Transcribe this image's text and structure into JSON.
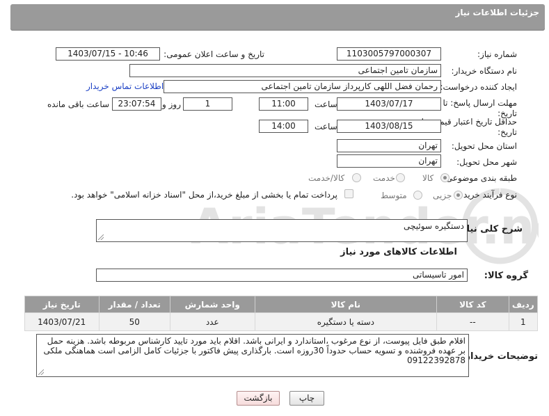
{
  "header": {
    "title": "جزئیات اطلاعات نیاز"
  },
  "form": {
    "need_number_label": "شماره نیاز:",
    "need_number": "1103005797000307",
    "announce_label": "تاریخ و ساعت اعلان عمومی:",
    "announce_value": "1403/07/15 - 10:46",
    "buyer_org_label": "نام دستگاه خریدار:",
    "buyer_org": "سازمان تامین اجتماعی",
    "requester_label": "ایجاد کننده درخواست:",
    "requester": "رحمان فضل اللهی کارپرداز سازمان تامین اجتماعی",
    "buyer_contact_link": "اطلاعات تماس خریدار",
    "reply_deadline_label_1": "مهلت ارسال پاسخ: تا",
    "reply_deadline_label_2": "تاریخ:",
    "reply_date": "1403/07/17",
    "time_label": "ساعت",
    "reply_time": "11:00",
    "days_value": "1",
    "days_label": "روز و",
    "remaining_time": "23:07:54",
    "remaining_label": "ساعت باقی مانده",
    "price_validity_label_1": "حداقل تاریخ اعتبار قیمت: تا",
    "price_validity_label_2": "تاریخ:",
    "validity_date": "1403/08/15",
    "validity_time": "14:00",
    "province_label": "استان محل تحویل:",
    "province": "تهران",
    "city_label": "شهر محل تحویل:",
    "city": "تهران",
    "category_label": "طبقه بندی موضوعی:",
    "category_options": [
      "کالا",
      "خدمت",
      "کالا/خدمت"
    ],
    "purchase_type_label": "نوع فرآیند خرید :",
    "purchase_options": [
      "جزیی",
      "متوسط"
    ],
    "payment_note": "پرداخت تمام یا بخشی از مبلغ خرید،از محل \"اسناد خزانه اسلامی\" خواهد بود."
  },
  "description": {
    "label": "شرح کلی نیاز:",
    "value": "دستگیره سوئیچی"
  },
  "goods": {
    "section_title": "اطلاعات کالاهای مورد نیاز",
    "group_label": "گروه کالا:",
    "group_value": "امور تاسیساتی",
    "columns": [
      "ردیف",
      "کد کالا",
      "نام کالا",
      "واحد شمارش",
      "تعداد / مقدار",
      "تاریخ نیاز"
    ],
    "rows": [
      [
        "1",
        "--",
        "دسته یا دستگیره",
        "عدد",
        "50",
        "1403/07/21"
      ]
    ]
  },
  "buyer_notes": {
    "label": "توضیحات خریدار:",
    "value": "اقلام طبق فایل پیوست، از نوع مرغوب ،استاندارد و ایرانی باشد. اقلام باید مورد تایید کارشناس مربوطه باشد. هزینه حمل بر عهده فروشنده و تسویه حساب حدوداً 30روزه است. بارگذاری پیش فاکتور با جزئیات کامل الزامی است هماهنگی ملکی 09122392878"
  },
  "buttons": {
    "print": "چاپ",
    "back": "بازگشت"
  },
  "watermark": {
    "text": "AriaTender.neT"
  },
  "colors": {
    "header_bg": "#9a9a9a",
    "link": "#1a3fc4",
    "back_button": "#f6dcdc"
  }
}
